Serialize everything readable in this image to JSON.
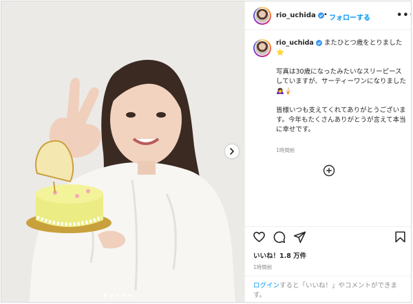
{
  "post": {
    "username": "rio_uchida",
    "separator": "•",
    "follow_label": "フォローする",
    "more_label": "•••",
    "caption_text": "またひとつ歳をとりました⭐",
    "body": {
      "p1": "写真は30歳になったみたいなスリーピースしていますが、サーティーワンになりました🙇‍♀️🍦",
      "p2": "皆様いつも支えてくれてありがとうございます。今年もたくさんありがとうが言えて本当に幸せです。"
    },
    "caption_time": "1時間前",
    "likes": "いいね！1.8 万件",
    "time_ago": "1時間前",
    "login_link": "ログイン",
    "login_rest": "すると「いいね！」やコメントができます。"
  },
  "carousel": {
    "total": 5,
    "active_index": 0
  },
  "colors": {
    "link": "#0095f6",
    "text": "#262626",
    "muted": "#8e8e8e",
    "verified": "#3897f0"
  },
  "icons": [
    "verified-icon",
    "next-arrow-icon",
    "add-circle-icon",
    "heart-icon",
    "comment-icon",
    "share-icon",
    "bookmark-icon"
  ]
}
